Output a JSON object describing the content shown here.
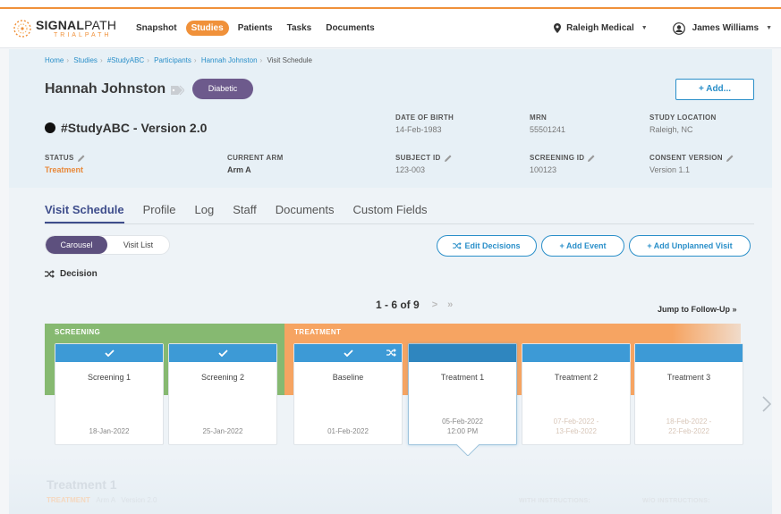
{
  "app": {
    "logo_main_bold": "SIGNAL",
    "logo_main_thin": "PATH",
    "logo_sub": "TRIALPATH"
  },
  "nav": {
    "links": [
      "Snapshot",
      "Studies",
      "Patients",
      "Tasks",
      "Documents"
    ],
    "active": "Studies",
    "location": "Raleigh Medical",
    "user": "James Williams"
  },
  "breadcrumb": [
    "Home",
    "Studies",
    "#StudyABC",
    "Participants",
    "Hannah Johnston",
    "Visit Schedule"
  ],
  "patient": {
    "name": "Hannah Johnston",
    "badge": "Diabetic",
    "add_label": "+ Add...",
    "study": "#StudyABC - Version 2.0"
  },
  "fields": {
    "dob_label": "DATE OF BIRTH",
    "dob": "14-Feb-1983",
    "mrn_label": "MRN",
    "mrn": "55501241",
    "loc_label": "STUDY LOCATION",
    "loc": "Raleigh, NC",
    "status_label": "STATUS",
    "status": "Treatment",
    "arm_label": "CURRENT ARM",
    "arm": "Arm A",
    "subject_label": "SUBJECT ID",
    "subject": "123-003",
    "screening_label": "SCREENING ID",
    "screening": "100123",
    "consent_label": "CONSENT VERSION",
    "consent": "Version 1.1"
  },
  "tabs": [
    "Visit Schedule",
    "Profile",
    "Log",
    "Staff",
    "Documents",
    "Custom Fields"
  ],
  "view_toggle": {
    "carousel": "Carousel",
    "list": "Visit List"
  },
  "actions": {
    "edit_decisions": "Edit Decisions",
    "add_event": "+ Add Event",
    "add_unplanned": "+ Add Unplanned Visit"
  },
  "decision_label": "Decision",
  "pager": {
    "text": "1 - 6 of 9",
    "arrows": "> »"
  },
  "jump": "Jump to Follow-Up »",
  "bands": {
    "screening": "SCREENING",
    "treatment": "TREATMENT"
  },
  "visits": [
    {
      "title": "Screening 1",
      "date": "18-Jan-2022",
      "date2": ""
    },
    {
      "title": "Screening 2",
      "date": "25-Jan-2022",
      "date2": ""
    },
    {
      "title": "Baseline",
      "date": "01-Feb-2022",
      "date2": ""
    },
    {
      "title": "Treatment 1",
      "date": "05-Feb-2022",
      "date2": "12:00 PM"
    },
    {
      "title": "Treatment 2",
      "date": "07-Feb-2022 -",
      "date2": "13-Feb-2022"
    },
    {
      "title": "Treatment 3",
      "date": "18-Feb-2022 -",
      "date2": "22-Feb-2022"
    }
  ],
  "detail": {
    "title": "Treatment 1",
    "status": "TREATMENT",
    "arm": "Arm A",
    "version": "Version 2.0",
    "with_instr": "WITH INSTRUCTIONS:",
    "wo_instr": "W/O INSTRUCTIONS:"
  },
  "colors": {
    "accent": "#f0913a",
    "blue": "#2a8fc9",
    "purple": "#6d5a8c",
    "screening": "#86b971",
    "treatment": "#f6a462",
    "cap": "#3d9ad6"
  }
}
